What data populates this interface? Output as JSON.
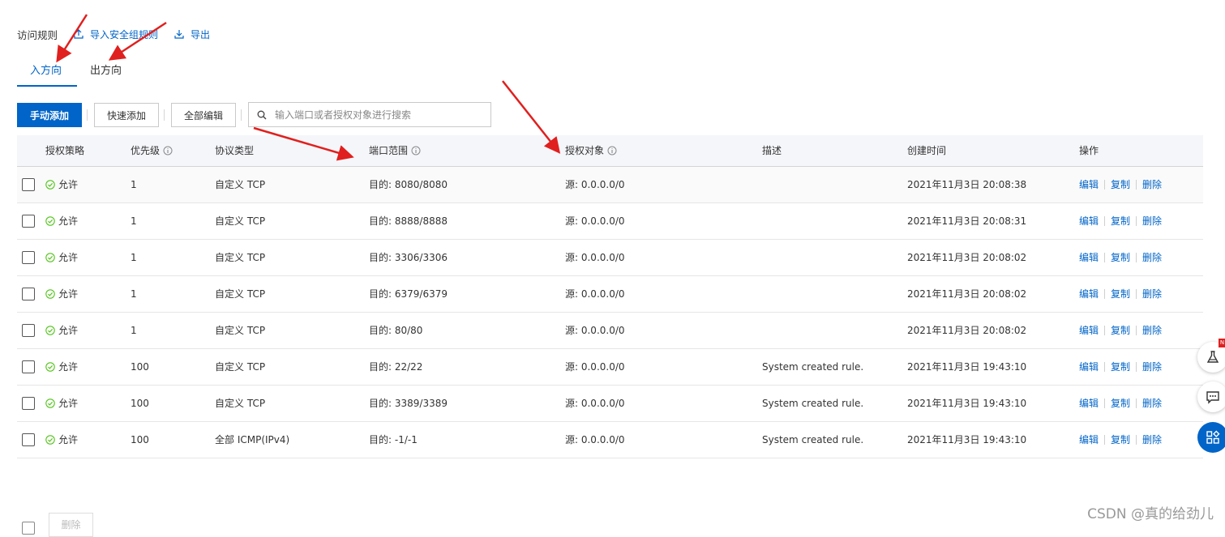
{
  "header": {
    "title": "访问规则",
    "import_label": "导入安全组规则",
    "export_label": "导出"
  },
  "tabs": [
    {
      "label": "入方向",
      "active": true
    },
    {
      "label": "出方向",
      "active": false
    }
  ],
  "toolbar": {
    "manual_add": "手动添加",
    "quick_add": "快速添加",
    "edit_all": "全部编辑",
    "search_placeholder": "输入端口或者授权对象进行搜索"
  },
  "columns": [
    "授权策略",
    "优先级",
    "协议类型",
    "端口范围",
    "授权对象",
    "描述",
    "创建时间",
    "操作"
  ],
  "rows": [
    {
      "policy": "允许",
      "priority": "1",
      "protocol": "自定义 TCP",
      "port": "目的: 8080/8080",
      "source": "源: 0.0.0.0/0",
      "desc": "",
      "time": "2021年11月3日 20:08:38"
    },
    {
      "policy": "允许",
      "priority": "1",
      "protocol": "自定义 TCP",
      "port": "目的: 8888/8888",
      "source": "源: 0.0.0.0/0",
      "desc": "",
      "time": "2021年11月3日 20:08:31"
    },
    {
      "policy": "允许",
      "priority": "1",
      "protocol": "自定义 TCP",
      "port": "目的: 3306/3306",
      "source": "源: 0.0.0.0/0",
      "desc": "",
      "time": "2021年11月3日 20:08:02"
    },
    {
      "policy": "允许",
      "priority": "1",
      "protocol": "自定义 TCP",
      "port": "目的: 6379/6379",
      "source": "源: 0.0.0.0/0",
      "desc": "",
      "time": "2021年11月3日 20:08:02"
    },
    {
      "policy": "允许",
      "priority": "1",
      "protocol": "自定义 TCP",
      "port": "目的: 80/80",
      "source": "源: 0.0.0.0/0",
      "desc": "",
      "time": "2021年11月3日 20:08:02"
    },
    {
      "policy": "允许",
      "priority": "100",
      "protocol": "自定义 TCP",
      "port": "目的: 22/22",
      "source": "源: 0.0.0.0/0",
      "desc": "System created rule.",
      "time": "2021年11月3日 19:43:10"
    },
    {
      "policy": "允许",
      "priority": "100",
      "protocol": "自定义 TCP",
      "port": "目的: 3389/3389",
      "source": "源: 0.0.0.0/0",
      "desc": "System created rule.",
      "time": "2021年11月3日 19:43:10"
    },
    {
      "policy": "允许",
      "priority": "100",
      "protocol": "全部 ICMP(IPv4)",
      "port": "目的: -1/-1",
      "source": "源: 0.0.0.0/0",
      "desc": "System created rule.",
      "time": "2021年11月3日 19:43:10"
    }
  ],
  "row_actions": {
    "edit": "编辑",
    "copy": "复制",
    "delete": "删除"
  },
  "footer": {
    "delete_label": "删除"
  },
  "badge": "N",
  "watermark": "CSDN @真的给劲儿",
  "colors": {
    "accent": "#0064c8",
    "allow": "#52c41a",
    "arrow": "#e0201e"
  }
}
